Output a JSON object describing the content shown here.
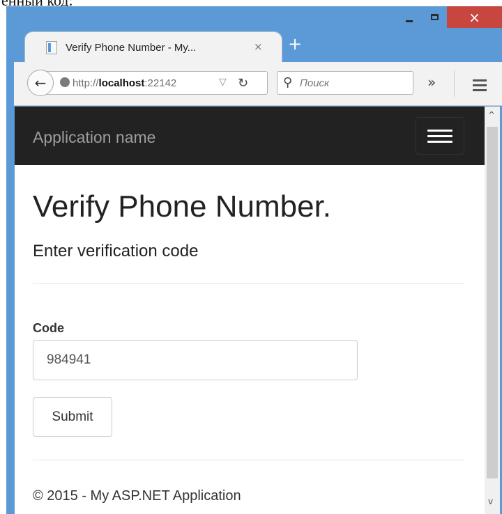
{
  "document": {
    "cut_text": "ённый код:"
  },
  "browser": {
    "tab_title": "Verify Phone Number - My...",
    "tab_close": "×",
    "new_tab": "+",
    "window_close": "×",
    "url_prefix": "http://",
    "url_host": "localhost",
    "url_suffix": ":22142",
    "search_placeholder": "Поиск",
    "overflow": "»"
  },
  "site": {
    "brand": "Application name",
    "page_title": "Verify Phone Number.",
    "subtitle": "Enter verification code",
    "form": {
      "code_label": "Code",
      "code_value": "984941",
      "submit_label": "Submit"
    },
    "footer": "© 2015 - My ASP.NET Application"
  },
  "colors": {
    "frame": "#5b9ad6",
    "navbar": "#222222",
    "close_button": "#c7463f"
  }
}
